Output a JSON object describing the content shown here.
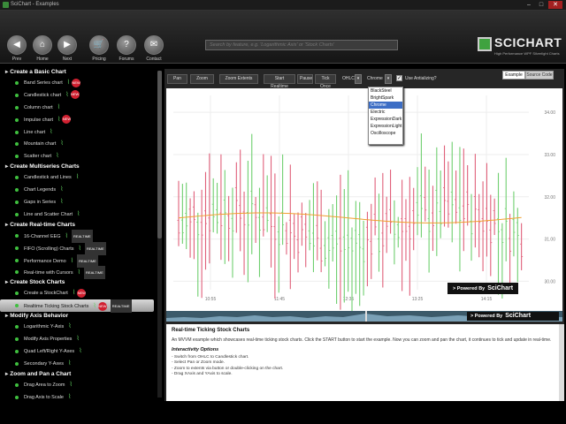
{
  "window": {
    "title": "SciChart - Examples",
    "minimize": "–",
    "maximize": "□",
    "close": "✕"
  },
  "toolbar": {
    "buttons": [
      {
        "label": "Prev",
        "glyph": "◀"
      },
      {
        "label": "Home",
        "glyph": "⌂"
      },
      {
        "label": "Next",
        "glyph": "▶"
      },
      {
        "label": "Pricing",
        "glyph": "🛒"
      },
      {
        "label": "Forums",
        "glyph": "?"
      },
      {
        "label": "Contact",
        "glyph": "✉"
      }
    ],
    "search_placeholder": "Search by feature, e.g. 'Logarithmic Axis' or 'Stock Charts'",
    "logo": {
      "word": "SCICHART",
      "tagline": "High Performance WPF Silverlight Charts"
    }
  },
  "sidebar": {
    "categories": [
      {
        "title": "Create a Basic Chart",
        "items": [
          {
            "label": "Band Series chart",
            "new": true
          },
          {
            "label": "Candlestick chart",
            "new": true
          },
          {
            "label": "Column chart"
          },
          {
            "label": "Impulse chart",
            "new": true
          },
          {
            "label": "Line chart"
          },
          {
            "label": "Mountain chart"
          },
          {
            "label": "Scatter chart"
          }
        ]
      },
      {
        "title": "Create Multiseries Charts",
        "items": [
          {
            "label": "Candlestick and Lines"
          },
          {
            "label": "Chart Legends"
          },
          {
            "label": "Gaps in Series"
          },
          {
            "label": "Line and Scatter Chart"
          }
        ]
      },
      {
        "title": "Create Real-time Charts",
        "items": [
          {
            "label": "16-Channel EEG",
            "rt": true
          },
          {
            "label": "FIFO (Scrolling) Charts",
            "rt": true
          },
          {
            "label": "Performance Demo",
            "rt": true
          },
          {
            "label": "Real-time with Cursors",
            "rt": true
          }
        ]
      },
      {
        "title": "Create Stock Charts",
        "items": [
          {
            "label": "Create a StockChart",
            "new": true
          },
          {
            "label": "Realtime Ticking Stock Charts",
            "new": true,
            "rt": true,
            "selected": true
          }
        ]
      },
      {
        "title": "Modify Axis Behavior",
        "items": [
          {
            "label": "Logarithmic Y-Axis"
          },
          {
            "label": "Modify Axis Properties"
          },
          {
            "label": "Quad Left/Right Y-Axes"
          },
          {
            "label": "Secondary Y-Axes"
          }
        ]
      },
      {
        "title": "Zoom and Pan a Chart",
        "items": [
          {
            "label": "Drag Area to Zoom"
          },
          {
            "label": "Drag Axis to Scale"
          }
        ]
      }
    ],
    "badge_new": "NEW",
    "badge_rt": "REALTIME"
  },
  "example_toolbar": {
    "pan": "Pan",
    "zoom": "Zoom",
    "zoom_extents": "Zoom Extents",
    "start_realtime": "Start Realtime",
    "pause": "Pause",
    "tick_once": "Tick Once",
    "ohlc_label": "OHLC",
    "chrome_label": "Chrome",
    "antialias_label": "Use Antializing?",
    "tab_example": "Example",
    "tab_source": "Source Code"
  },
  "theme_dropdown": {
    "options": [
      "BlackSteel",
      "BrightSpark",
      "Chrome",
      "Electric",
      "ExpressionDark",
      "ExpressionLight",
      "Oscilloscope"
    ],
    "highlighted_index": 2
  },
  "chart_data": {
    "type": "candlestick",
    "x_tick_labels": [
      "10:55",
      "11:45",
      "12:35",
      "13:25",
      "14:15"
    ],
    "y_tick_labels": [
      "34.00",
      "33.00",
      "32.00",
      "31.00",
      "30.00"
    ],
    "ylim": [
      29.8,
      34.4
    ],
    "moving_average_color": "#f0a030",
    "up_color": "#6fcf6f",
    "down_color": "#e0607a",
    "grid": true
  },
  "powered_by": {
    "prefix": "> Powered By",
    "brand": "SciChart"
  },
  "description": {
    "title": "Real-time Ticking Stock Charts",
    "intro": "An MVVM example which showcases real-time ticking stock charts. Click the START button to start the example. Now you can zoom and pan the chart, it continues to tick and update in real-time.",
    "subtitle": "Interactivity Options",
    "bullets": [
      "- Switch from OHLC to Candlestick chart.",
      "- Select Pan or Zoom mode.",
      "- Zoom to extents via button or double-clicking on the chart.",
      "- Drag XAxis and YAxis to scale."
    ]
  }
}
